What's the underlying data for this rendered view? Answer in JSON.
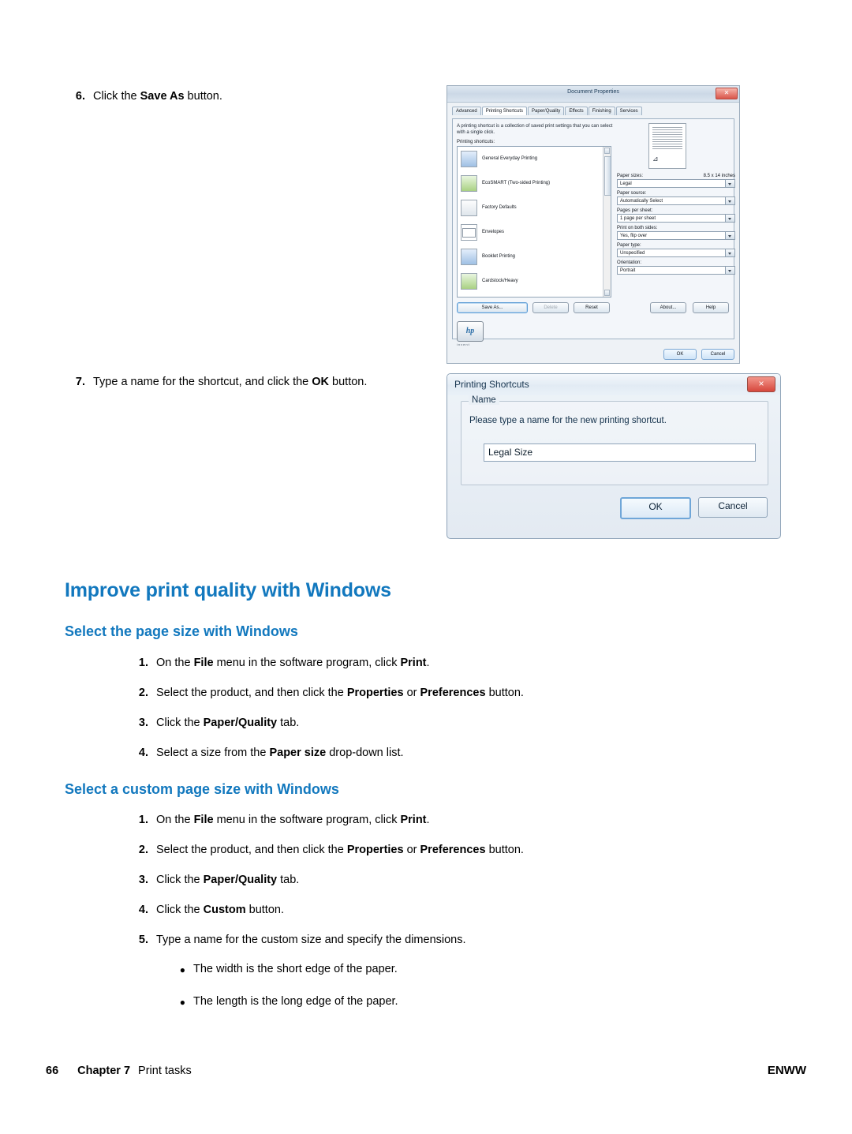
{
  "steps_top": [
    {
      "num": "6.",
      "pre": "Click the ",
      "bold": "Save As",
      "post": " button."
    },
    {
      "num": "7.",
      "pre": "Type a name for the shortcut, and click the ",
      "bold": "OK",
      "post": " button."
    }
  ],
  "section": {
    "h1": "Improve print quality with Windows",
    "sub1": {
      "h2": "Select the page size with Windows",
      "steps": [
        {
          "num": "1.",
          "p1": "On the ",
          "b1": "File",
          "p2": " menu in the software program, click ",
          "b2": "Print",
          "p3": "."
        },
        {
          "num": "2.",
          "p1": "Select the product, and then click the ",
          "b1": "Properties",
          "p2": " or ",
          "b2": "Preferences",
          "p3": " button."
        },
        {
          "num": "3.",
          "p1": "Click the ",
          "b1": "Paper/Quality",
          "p2": " tab.",
          "b2": "",
          "p3": ""
        },
        {
          "num": "4.",
          "p1": "Select a size from the ",
          "b1": "Paper size",
          "p2": " drop-down list.",
          "b2": "",
          "p3": ""
        }
      ]
    },
    "sub2": {
      "h2": "Select a custom page size with Windows",
      "steps": [
        {
          "num": "1.",
          "p1": "On the ",
          "b1": "File",
          "p2": " menu in the software program, click ",
          "b2": "Print",
          "p3": "."
        },
        {
          "num": "2.",
          "p1": "Select the product, and then click the ",
          "b1": "Properties",
          "p2": " or ",
          "b2": "Preferences",
          "p3": " button."
        },
        {
          "num": "3.",
          "p1": "Click the ",
          "b1": "Paper/Quality",
          "p2": " tab.",
          "b2": "",
          "p3": ""
        },
        {
          "num": "4.",
          "p1": "Click the ",
          "b1": "Custom",
          "p2": " button.",
          "b2": "",
          "p3": ""
        },
        {
          "num": "5.",
          "p1": "Type a name for the custom size and specify the dimensions.",
          "b1": "",
          "p2": "",
          "b2": "",
          "p3": ""
        }
      ],
      "bullets": [
        "The width is the short edge of the paper.",
        "The length is the long edge of the paper."
      ]
    }
  },
  "footer": {
    "page": "66",
    "chapter": "Chapter 7",
    "chapter_title": "Print tasks",
    "right": "ENWW"
  },
  "screenshot_doc_properties": {
    "title": "Document Properties",
    "tabs": [
      "Advanced",
      "Printing Shortcuts",
      "Paper/Quality",
      "Effects",
      "Finishing",
      "Services"
    ],
    "active_tab": "Printing Shortcuts",
    "description": "A printing shortcut is a collection of saved print settings that you can select with a single click.",
    "list_label": "Printing shortcuts:",
    "shortcuts": [
      "General Everyday Printing",
      "EcoSMART (Two-sided Printing)",
      "Factory Defaults",
      "Envelopes",
      "Booklet Printing",
      "Cardstock/Heavy"
    ],
    "buttons": {
      "save_as": "Save As...",
      "delete": "Delete",
      "reset": "Reset",
      "about": "About...",
      "help": "Help",
      "ok": "OK",
      "cancel": "Cancel"
    },
    "fields": [
      {
        "label": "Paper sizes:",
        "hint": "8.5 x 14 inches",
        "value": "Legal"
      },
      {
        "label": "Paper source:",
        "hint": "",
        "value": "Automatically Select"
      },
      {
        "label": "Pages per sheet:",
        "hint": "",
        "value": "1 page per sheet"
      },
      {
        "label": "Print on both sides:",
        "hint": "",
        "value": "Yes, flip over"
      },
      {
        "label": "Paper type:",
        "hint": "",
        "value": "Unspecified"
      },
      {
        "label": "Orientation:",
        "hint": "",
        "value": "Portrait"
      }
    ],
    "brand": "hp",
    "brand_sub": "invent"
  },
  "screenshot_printing_shortcuts": {
    "title": "Printing Shortcuts",
    "group_label": "Name",
    "instruction": "Please type a name for the new printing shortcut.",
    "input_value": "Legal Size",
    "ok": "OK",
    "cancel": "Cancel",
    "close_icon": "×"
  }
}
